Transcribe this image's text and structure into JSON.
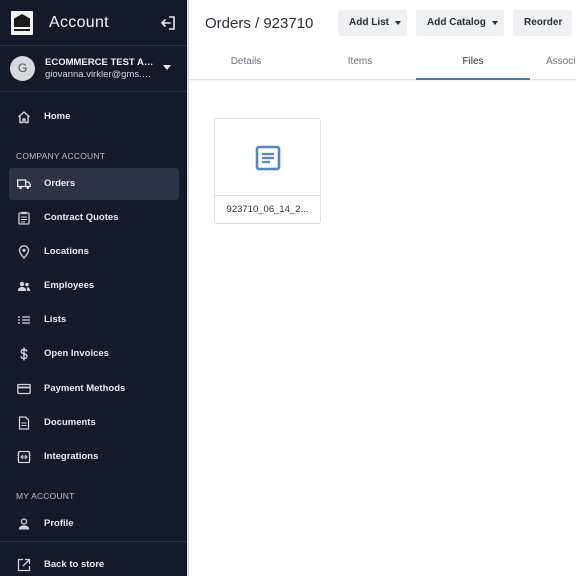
{
  "sidebar": {
    "title": "Account",
    "account": {
      "avatar_initial": "G",
      "name": "ECOMMERCE TEST ACC...",
      "email": "giovanna.virkler@gms.co..."
    },
    "home_label": "Home",
    "company_section": "COMPANY ACCOUNT",
    "company_items": [
      {
        "label": "Orders",
        "icon": "truck-icon",
        "active": true
      },
      {
        "label": "Contract Quotes",
        "icon": "clipboard-icon"
      },
      {
        "label": "Locations",
        "icon": "map-pin-icon"
      },
      {
        "label": "Employees",
        "icon": "people-icon"
      },
      {
        "label": "Lists",
        "icon": "list-icon"
      },
      {
        "label": "Open Invoices",
        "icon": "dollar-icon"
      },
      {
        "label": "Payment Methods",
        "icon": "credit-card-icon"
      },
      {
        "label": "Documents",
        "icon": "document-icon"
      },
      {
        "label": "Integrations",
        "icon": "integrations-icon"
      }
    ],
    "my_section": "MY ACCOUNT",
    "profile_label": "Profile",
    "back_label": "Back to store"
  },
  "header": {
    "title": "Orders / 923710",
    "add_list_label": "Add List",
    "add_catalog_label": "Add Catalog",
    "reorder_label": "Reorder"
  },
  "tabs": [
    {
      "label": "Details"
    },
    {
      "label": "Items"
    },
    {
      "label": "Files",
      "active": true
    },
    {
      "label": "Associ"
    }
  ],
  "files": [
    {
      "name": "923710_06_14_2..."
    }
  ],
  "colors": {
    "sidebar_bg": "#131a28",
    "active_item_bg": "#2c3444",
    "accent": "#4a79b8",
    "file_icon": "#4f86d6"
  }
}
